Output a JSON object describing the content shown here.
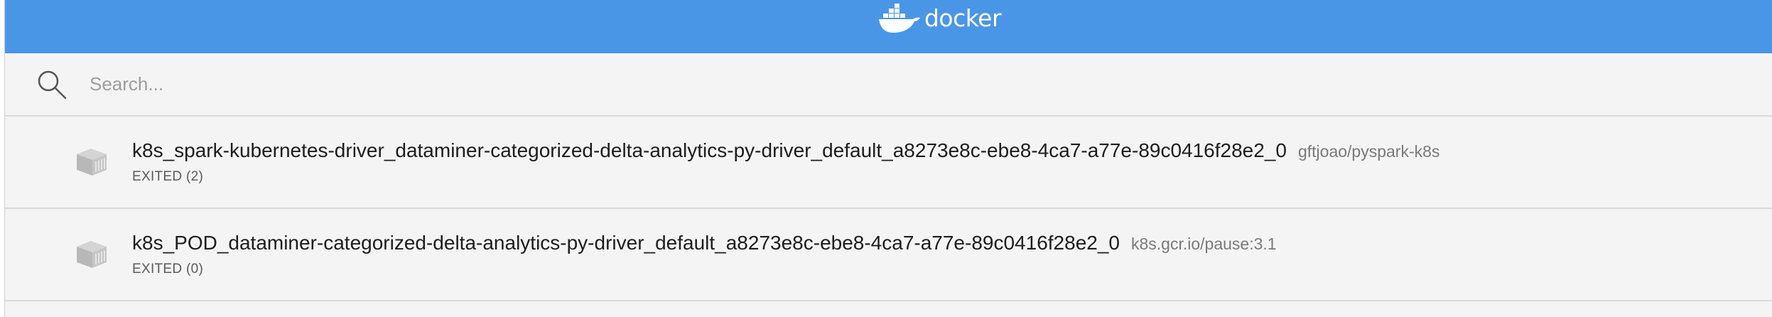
{
  "header": {
    "brand_text": "docker",
    "brand_icon": "docker-whale-icon"
  },
  "search": {
    "placeholder": "Search...",
    "value": ""
  },
  "containers": [
    {
      "name": "k8s_spark-kubernetes-driver_dataminer-categorized-delta-analytics-py-driver_default_a8273e8c-ebe8-4ca7-a77e-89c0416f28e2_0",
      "image": "gftjoao/pyspark-k8s",
      "status": "EXITED (2)"
    },
    {
      "name": "k8s_POD_dataminer-categorized-delta-analytics-py-driver_default_a8273e8c-ebe8-4ca7-a77e-89c0416f28e2_0",
      "image": "k8s.gcr.io/pause:3.1",
      "status": "EXITED (0)"
    }
  ],
  "colors": {
    "header_bg": "#4a96e6",
    "page_bg": "#f4f4f5",
    "divider": "#d9d9da"
  }
}
